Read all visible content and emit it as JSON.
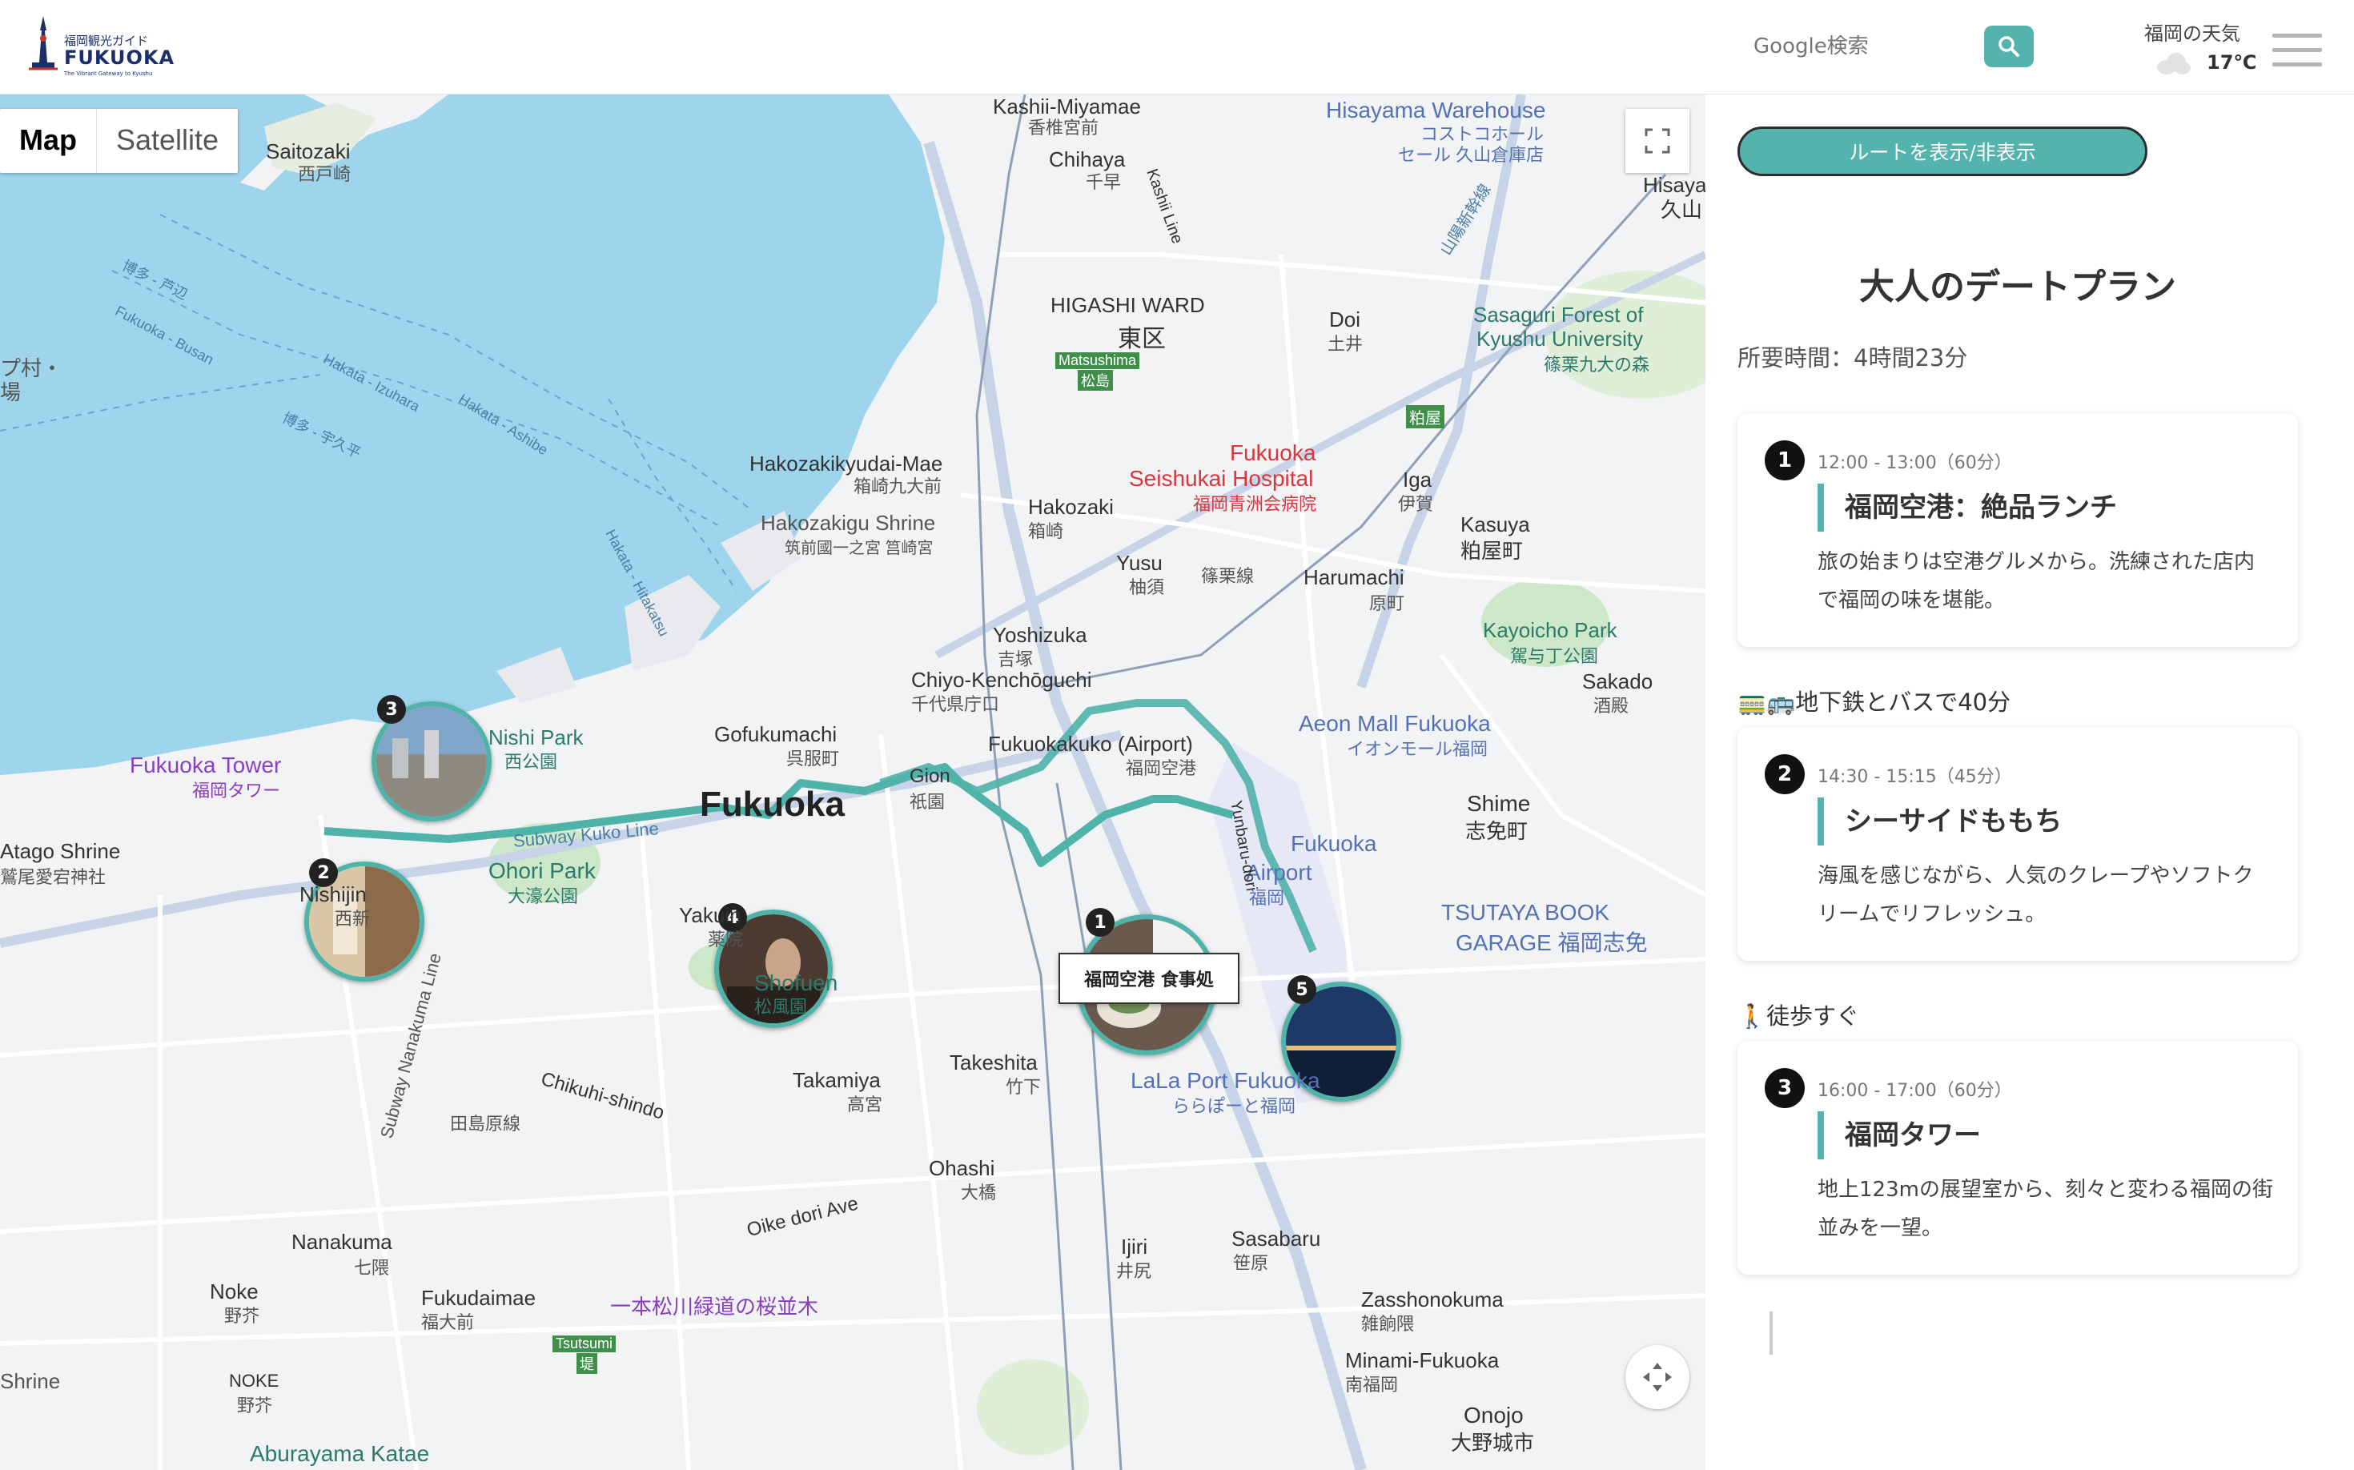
{
  "header": {
    "logo": {
      "small": "福岡観光ガイド",
      "big": "FUKUOKA",
      "tagline": "The Vibrant Gateway to Kyushu"
    },
    "search_placeholder": "Google検索",
    "weather_title": "福岡の天気",
    "weather_temp": "17℃"
  },
  "map": {
    "type_controls": [
      "Map",
      "Satellite"
    ],
    "popup_label": "福岡空港 食事処",
    "pins": [
      "1",
      "2",
      "3",
      "4",
      "5"
    ],
    "labels": {
      "kashii": "Kashii-Miyamae",
      "kashii_ja": "香椎宮前",
      "saitozaki": "Saitozaki",
      "saitozaki_ja": "西戸崎",
      "chihaya": "Chihaya",
      "chihaya_ja": "千早",
      "hisayama": "Hisayama Warehouse",
      "hisayama_ja1": "コストコホール",
      "hisayama_ja2": "セール 久山倉庫店",
      "hisaya": "Hisaya",
      "hisaya_ja": "久山",
      "higashi": "HIGASHI WARD",
      "higashi_ja": "東区",
      "matsushima": "Matsushima",
      "matsushima_ja": "松島",
      "doi": "Doi",
      "doi_ja": "土井",
      "sasaguri": "Sasaguri Forest of",
      "sasaguri2": "Kyushu University",
      "sasaguri_ja": "篠栗九大の森",
      "hakozakikyudai": "Hakozakikyudai-Mae",
      "hakozakikyudai_ja": "箱崎九大前",
      "seishukai1": "Fukuoka",
      "seishukai2": "Seishukai Hospital",
      "seishukai_ja": "福岡青洲会病院",
      "iga": "Iga",
      "iga_ja": "伊賀",
      "sasaya": "粕屋",
      "hakozaki": "Hakozaki",
      "hakozaki_ja": "箱崎",
      "hakozakigu": "Hakozakigu Shrine",
      "hakozakigu_ja": "筑前國一之宮 筥崎宮",
      "kasuya": "Kasuya",
      "kasuya_ja": "粕屋町",
      "yusu": "Yusu",
      "yusu_ja": "柚須",
      "sasaguri_line": "篠栗線",
      "harumachi": "Harumachi",
      "harumachi_ja": "原町",
      "yoshizuka": "Yoshizuka",
      "yoshizuka_ja": "吉塚",
      "kayoicho": "Kayoicho Park",
      "kayoicho_ja": "駕与丁公園",
      "chiyo": "Chiyo-Kenchōguchi",
      "chiyo_ja": "千代県庁口",
      "sakado": "Sakado",
      "sakado_ja": "酒殿",
      "aeon": "Aeon Mall Fukuoka",
      "aeon_ja": "イオンモール福岡",
      "nishipark": "Nishi Park",
      "nishipark_ja": "西公園",
      "gofukumachi": "Gofukumachi",
      "gofukumachi_ja": "呉服町",
      "airport": "Fukuokakuko (Airport)",
      "airport_ja": "福岡空港",
      "fukuokatower": "Fukuoka Tower",
      "fukuokatower_ja": "福岡タワー",
      "fukuoka_city": "Fukuoka",
      "gion": "Gion",
      "gion_ja": "祇園",
      "shime": "Shime",
      "shime_ja": "志免町",
      "fukuokaairport": "Fukuoka",
      "fukuokaairport2": "Airport",
      "fukuokaairport_ja": "福岡",
      "atago": "Atago Shrine",
      "atago_ja": "鷲尾愛宕神社",
      "ohori": "Ohori Park",
      "ohori_ja": "大濠公園",
      "nishijin": "Nishijin",
      "nishijin_ja": "西新",
      "yakuin": "Yakuin",
      "yakuin_ja": "薬院",
      "tsutaya1": "TSUTAYA BOOK",
      "tsutaya2": "GARAGE 福岡志免",
      "shofuen": "Shofuen",
      "shofuen_ja": "松風園",
      "takeshita": "Takeshita",
      "takeshita_ja": "竹下",
      "takamiya": "Takamiya",
      "takamiya_ja": "高宮",
      "chikuhi": "Chikuhi-shindo",
      "tajima": "田島原線",
      "lalaport": "LaLa Port Fukuoka",
      "lalaport_ja": "ららぽーと福岡",
      "ohashi": "Ohashi",
      "ohashi_ja": "大橋",
      "nanakuma": "Nanakuma",
      "nanakuma_ja": "七隈",
      "nanakuma_line": "Subway Nanakuma Line",
      "oike": "Oike dori Ave",
      "ijiri": "Ijiri",
      "ijiri_ja": "井尻",
      "sasabaru": "Sasabaru",
      "sasabaru_ja": "笹原",
      "noke": "Noke",
      "noke_ja": "野芥",
      "fukudaimae": "Fukudaimae",
      "fukudaimae_ja": "福大前",
      "matsukawa": "一本松川緑道の桜並木",
      "zasshonokuma": "Zasshonokuma",
      "zasshonokuma_ja": "雑餉隈",
      "tsutsumi": "Tsutsumi",
      "tsutsumi_ja": "堤",
      "minami": "Minami-Fukuoka",
      "minami_ja": "南福岡",
      "shrine": "Shrine",
      "noke2": "NOKE",
      "noke2_ja": "野芥",
      "onojo": "Onojo",
      "onojo_ja": "大野城市",
      "aburayama": "Aburayama Katae",
      "hakata_izuhara": "Hakata - Izuhara",
      "hakata_ashibe": "Hakata - Ashibe",
      "fukuoka_busan": "Fukuoka - Busan",
      "hakata_ashibe_ja": "博多 - 芦辺",
      "hakata_uku": "博多 - 宇久平",
      "hakata_hitakatsu": "Hakata - Hitakatsu",
      "sanyo": "山陽新幹線",
      "kashii_line": "Kashii Line",
      "yunbaru": "Yunbaru-dori",
      "subway_kuko": "Subway Kuko Line",
      "pt_mura": "プ村・",
      "pt_ba": "場"
    }
  },
  "panel": {
    "route_toggle": "ルートを表示/非表示",
    "title": "大人のデートプラン",
    "duration": "所要時間：4時間23分",
    "stops": [
      {
        "num": "1",
        "time": "12:00 - 13:00（60分）",
        "name": "福岡空港：絶品ランチ",
        "desc": "旅の始まりは空港グルメから。洗練された店内で福岡の味を堪能。"
      },
      {
        "num": "2",
        "time": "14:30 - 15:15（45分）",
        "name": "シーサイドももち",
        "desc": "海風を感じながら、人気のクレープやソフトクリームでリフレッシュ。"
      },
      {
        "num": "3",
        "time": "16:00 - 17:00（60分）",
        "name": "福岡タワー",
        "desc": "地上123mの展望室から、刻々と変わる福岡の街並みを一望。"
      }
    ],
    "transits": [
      "🚃🚌地下鉄とバスで40分",
      "🚶徒歩すぐ"
    ]
  },
  "colors": {
    "accent": "#55b3ad",
    "route": "#4fb3aa",
    "water": "#9ed4ec",
    "road": "#ffffff"
  }
}
